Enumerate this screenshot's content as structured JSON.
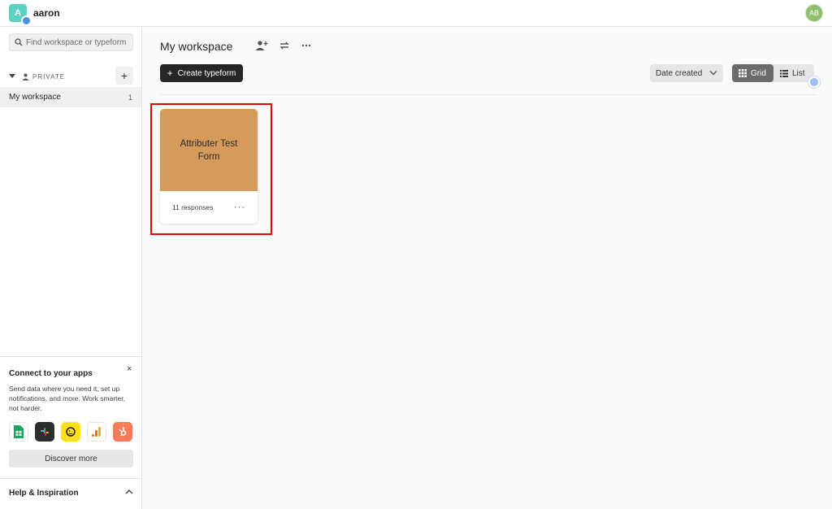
{
  "topbar": {
    "account_initial": "A",
    "account_name": "aaron",
    "user_initials": "AB"
  },
  "sidebar": {
    "search_placeholder": "Find workspace or typeform",
    "section_label": "PRIVATE",
    "add_label": "+",
    "workspaces": [
      {
        "name": "My workspace",
        "count": "1"
      }
    ],
    "connect": {
      "title": "Connect to your apps",
      "close": "×",
      "description": "Send data where you need it, set up notifications, and more. Work smarter, not harder.",
      "apps": [
        "google-sheets-icon",
        "slack-icon",
        "mailchimp-icon",
        "google-analytics-icon",
        "hubspot-icon"
      ],
      "discover_label": "Discover more"
    },
    "help_label": "Help & Inspiration"
  },
  "main": {
    "workspace_title": "My workspace",
    "create_label": "Create typeform",
    "create_plus": "+",
    "sort_label": "Date created",
    "view_grid_label": "Grid",
    "view_list_label": "List",
    "forms": [
      {
        "title": "Attributer Test Form",
        "responses": "11 responses",
        "more": "···",
        "cover_color": "#d69a5b"
      }
    ]
  },
  "colors": {
    "primary_button": "#262627",
    "account_avatar": "#5bd1c2",
    "highlight": "#e60000"
  }
}
